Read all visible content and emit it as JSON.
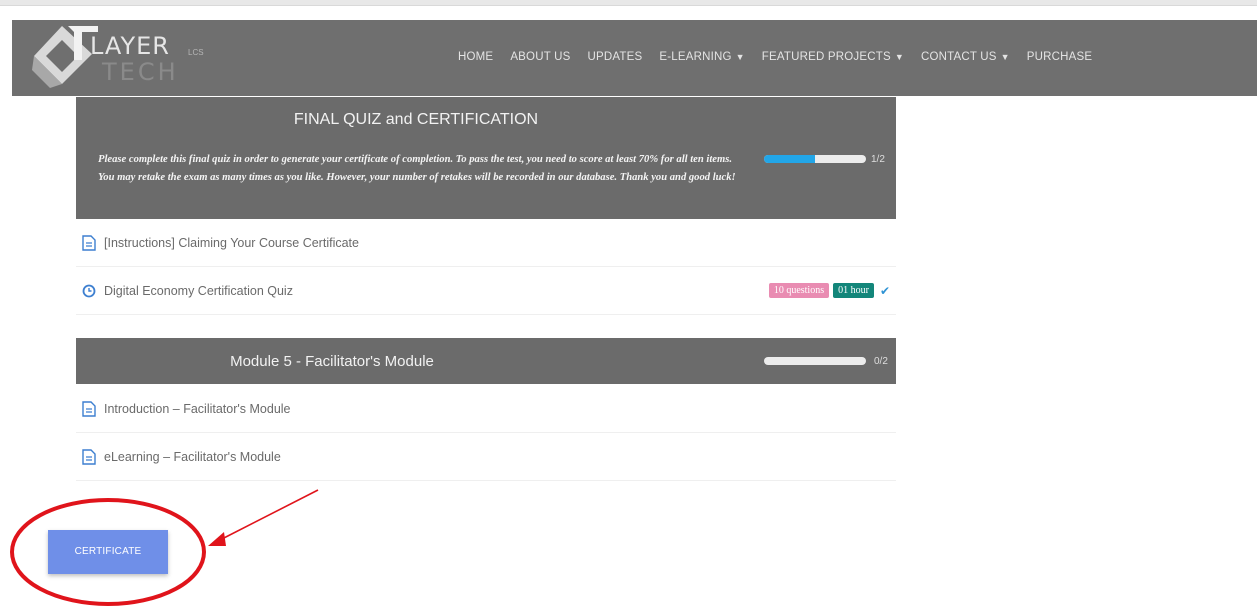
{
  "navbar": {
    "logo_text": "LAYER",
    "logo_text2": "TECH",
    "logo_sub": "LCS",
    "items": [
      {
        "label": "HOME",
        "dropdown": false
      },
      {
        "label": "ABOUT US",
        "dropdown": false
      },
      {
        "label": "UPDATES",
        "dropdown": false
      },
      {
        "label": "E-LEARNING",
        "dropdown": true
      },
      {
        "label": "FEATURED PROJECTS",
        "dropdown": true
      },
      {
        "label": "CONTACT US",
        "dropdown": true
      },
      {
        "label": "PURCHASE",
        "dropdown": false
      }
    ]
  },
  "final_section": {
    "title": "FINAL QUIZ and CERTIFICATION",
    "description": "Please complete this final quiz in order to generate your certificate of completion. To pass the test, you need to score at least 70% for all ten items. You may retake the exam as many times as you like. However, your number of retakes will be recorded in our database. Thank you and good luck!",
    "progress_fraction": 0.5,
    "progress_label": "1/2",
    "lessons": [
      {
        "label": "[Instructions] Claiming Your Course Certificate",
        "icon": "document-icon"
      },
      {
        "label": "Digital Economy Certification Quiz",
        "icon": "clock-icon",
        "badge_questions": "10 questions",
        "badge_time": "01 hour",
        "completed": true
      }
    ]
  },
  "module5": {
    "title": "Module 5 - Facilitator's Module",
    "progress_fraction": 0,
    "progress_label": "0/2",
    "lessons": [
      {
        "label": "Introduction – Facilitator's Module",
        "icon": "document-icon"
      },
      {
        "label": "eLearning – Facilitator's Module",
        "icon": "document-icon"
      }
    ]
  },
  "certificate_button": "CERTIFICATE",
  "colors": {
    "accent_progress": "#22a6e8",
    "button": "#6f8fe8",
    "badge_pink": "#e98cb2",
    "badge_teal": "#13867a",
    "annotation_red": "#e0141b"
  }
}
